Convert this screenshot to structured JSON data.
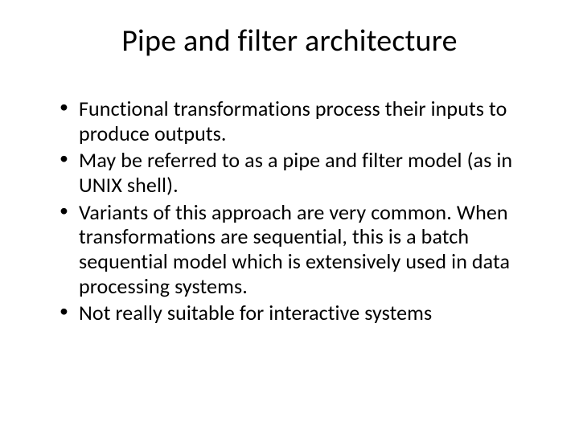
{
  "slide": {
    "title": "Pipe and filter architecture",
    "bullets": [
      "Functional transformations process their inputs to produce outputs.",
      "May be referred to as a pipe and filter model (as in UNIX shell).",
      "Variants of this approach are very common. When transformations are sequential, this is a batch sequential model which is extensively used in data processing systems.",
      "Not really suitable for interactive systems"
    ]
  }
}
